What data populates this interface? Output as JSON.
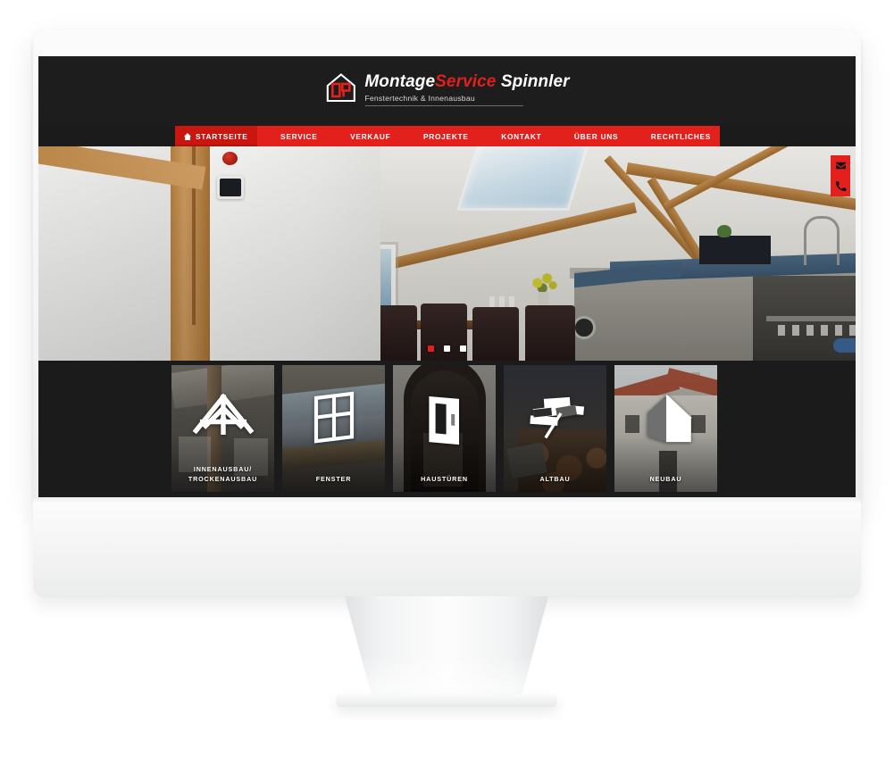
{
  "site": {
    "logo": {
      "icon": "house-logo-icon",
      "title_part1": "Montage",
      "title_part2": "Service",
      "title_part3": " Spinnler",
      "subtitle": "Fenstertechnik & Innenausbau"
    },
    "nav": {
      "items": [
        {
          "label": "STARTSEITE",
          "active": true,
          "icon": "home-icon"
        },
        {
          "label": "SERVICE",
          "active": false
        },
        {
          "label": "VERKAUF",
          "active": false
        },
        {
          "label": "PROJEKTE",
          "active": false
        },
        {
          "label": "KONTAKT",
          "active": false
        },
        {
          "label": "ÜBER UNS",
          "active": false
        },
        {
          "label": "RECHTLICHES",
          "active": false
        }
      ]
    },
    "hero": {
      "alt": "Dachgeschoss Wohnraum mit Holzbalken und Dachfenster",
      "slider_dots": [
        {
          "active": true
        },
        {
          "active": false
        },
        {
          "active": false
        }
      ]
    },
    "side_buttons": [
      {
        "name": "email-button",
        "icon": "envelope-icon"
      },
      {
        "name": "phone-button",
        "icon": "phone-icon"
      }
    ],
    "categories": [
      {
        "label": "INNENAUSBAU/\nTROCKENAUSBAU",
        "label_line1": "INNENAUSBAU/",
        "label_line2": "TROCKENAUSBAU",
        "icon": "truss-icon"
      },
      {
        "label": "FENSTER",
        "label_line1": "FENSTER",
        "label_line2": "",
        "icon": "window-icon"
      },
      {
        "label": "HAUSTÜREN",
        "label_line1": "HAUSTÜREN",
        "label_line2": "",
        "icon": "door-icon"
      },
      {
        "label": "ALTBAU",
        "label_line1": "ALTBAU",
        "label_line2": "",
        "icon": "old-building-icon"
      },
      {
        "label": "NEUBAU",
        "label_line1": "NEUBAU",
        "label_line2": "",
        "icon": "new-house-icon"
      }
    ],
    "colors": {
      "brand_red": "#e3211c",
      "brand_red_dark": "#c9160f",
      "header_dark": "#1d1d1d",
      "text_white": "#ffffff"
    }
  }
}
